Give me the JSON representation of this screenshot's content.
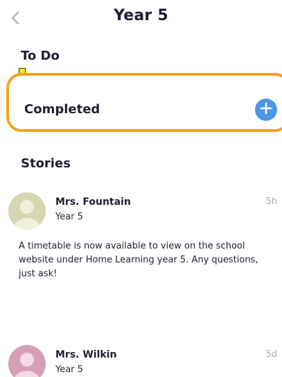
{
  "header": {
    "title": "Year 5",
    "back_icon": "chevron-left-icon"
  },
  "sections": {
    "todo": "To Do",
    "completed": "Completed",
    "stories": "Stories"
  },
  "completed_add_icon": "plus-circle-icon",
  "colors": {
    "highlight_border": "#f5a21a",
    "add_button": "#4a98e6",
    "marker": "#ffee00",
    "muted_text": "#a7a7ba"
  },
  "stories": [
    {
      "author": "Mrs. Fountain",
      "group": "Year 5",
      "time": "5h",
      "text": "A timetable is now available to view on the school website under Home Learning year 5. Any questions, just ask!"
    },
    {
      "author": "Mrs. Wilkin",
      "group": "Year 5",
      "time": "5d"
    }
  ]
}
